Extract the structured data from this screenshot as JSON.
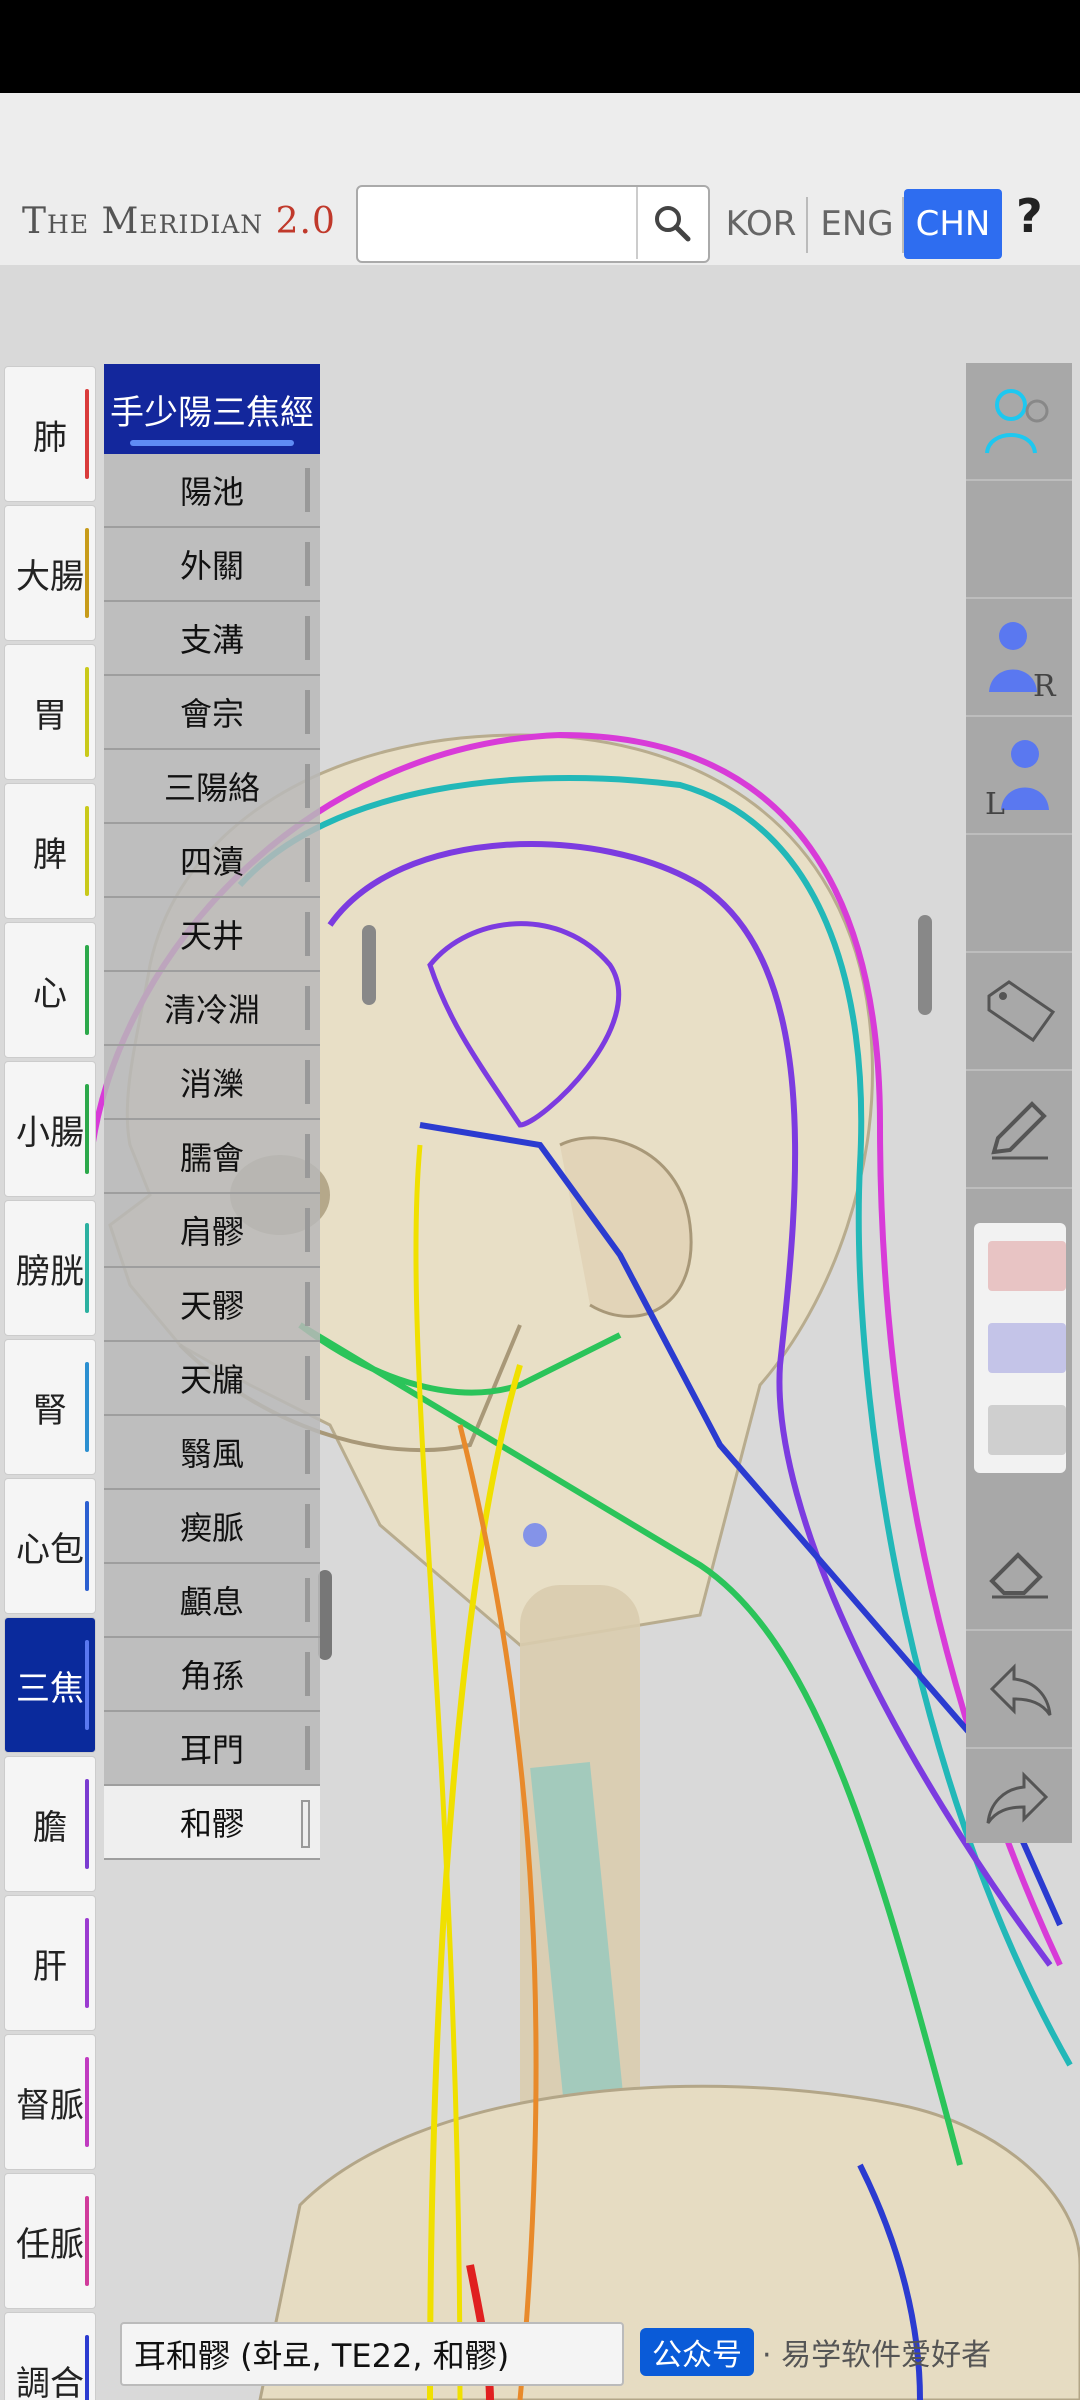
{
  "header": {
    "brand_text": "The Meridian",
    "brand_version": "2.0",
    "search_placeholder": "",
    "languages": [
      "KOR",
      "ENG",
      "CHN"
    ],
    "active_language": "CHN",
    "help": "?"
  },
  "meridians": [
    {
      "label": "肺",
      "color": "#d93b3b"
    },
    {
      "label": "大腸",
      "color": "#c79b1a"
    },
    {
      "label": "胃",
      "color": "#c9c91a"
    },
    {
      "label": "脾",
      "color": "#c9c91a"
    },
    {
      "label": "心",
      "color": "#2ba84a"
    },
    {
      "label": "小腸",
      "color": "#2ba84a"
    },
    {
      "label": "膀胱",
      "color": "#2bb0a0"
    },
    {
      "label": "腎",
      "color": "#2b8fd0"
    },
    {
      "label": "心包",
      "color": "#2b5fd0"
    },
    {
      "label": "三焦",
      "color": "#5a78f0",
      "active": true
    },
    {
      "label": "膽",
      "color": "#7a3bd0"
    },
    {
      "label": "肝",
      "color": "#9b3bd0"
    },
    {
      "label": "督脈",
      "color": "#c03bc0"
    },
    {
      "label": "任脈",
      "color": "#d03b9b"
    },
    {
      "label": "調合",
      "color": "#2b3bd0"
    }
  ],
  "point_list": {
    "title": "手少陽三焦經",
    "items": [
      "陽池",
      "外關",
      "支溝",
      "會宗",
      "三陽絡",
      "四瀆",
      "天井",
      "清冷淵",
      "消濼",
      "臑會",
      "肩髎",
      "天髎",
      "天牖",
      "翳風",
      "瘈脈",
      "顱息",
      "角孫",
      "耳門",
      "和髎"
    ],
    "selected": "和髎"
  },
  "tools": {
    "icons": [
      "person-view-icon",
      "blank",
      "right-side-icon",
      "left-side-icon",
      "blank",
      "name-tag-icon",
      "pencil-icon",
      "eraser-icon",
      "undo-icon",
      "redo-icon"
    ],
    "swatch_colors": [
      "#e8c4c4",
      "#c4c4e8",
      "#cfcfcf"
    ]
  },
  "info_bar": {
    "text": "耳和髎 (화료, TE22, 和髎)"
  },
  "watermark": {
    "pub": "公众号",
    "account": "· 易学软件爱好者"
  }
}
